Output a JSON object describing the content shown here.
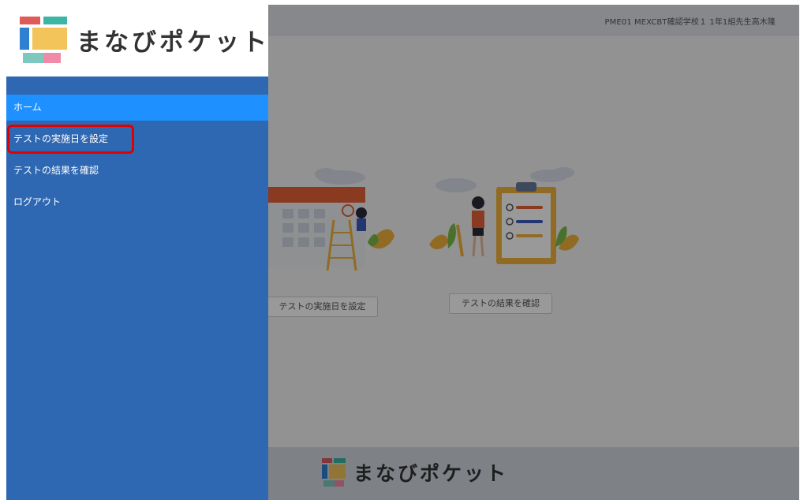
{
  "app": {
    "title": "まなびポケット",
    "user_info": "PME01  MEXCBT確認学校１ 1年1組先生高木隆"
  },
  "sidebar": {
    "items": [
      {
        "label": "ホーム",
        "active": true
      },
      {
        "label": "テストの実施日を設定",
        "active": false,
        "highlighted": true
      },
      {
        "label": "テストの結果を確認",
        "active": false
      },
      {
        "label": "ログアウト",
        "active": false
      }
    ]
  },
  "main": {
    "cards": [
      {
        "button_label": "テストの実施日を設定",
        "icon": "calendar-illustration"
      },
      {
        "button_label": "テストの結果を確認",
        "icon": "clipboard-illustration"
      }
    ]
  },
  "footer": {
    "title": "まなびポケット"
  },
  "colors": {
    "sidebar_bg": "#2f68b2",
    "active_item_bg": "#1e90ff",
    "highlight_border": "#e00000",
    "logo_red": "#e05a5a",
    "logo_teal": "#3db5a5",
    "logo_blue": "#2f7fd3",
    "logo_yellow": "#f2c45a",
    "logo_pink": "#f08aa6"
  }
}
